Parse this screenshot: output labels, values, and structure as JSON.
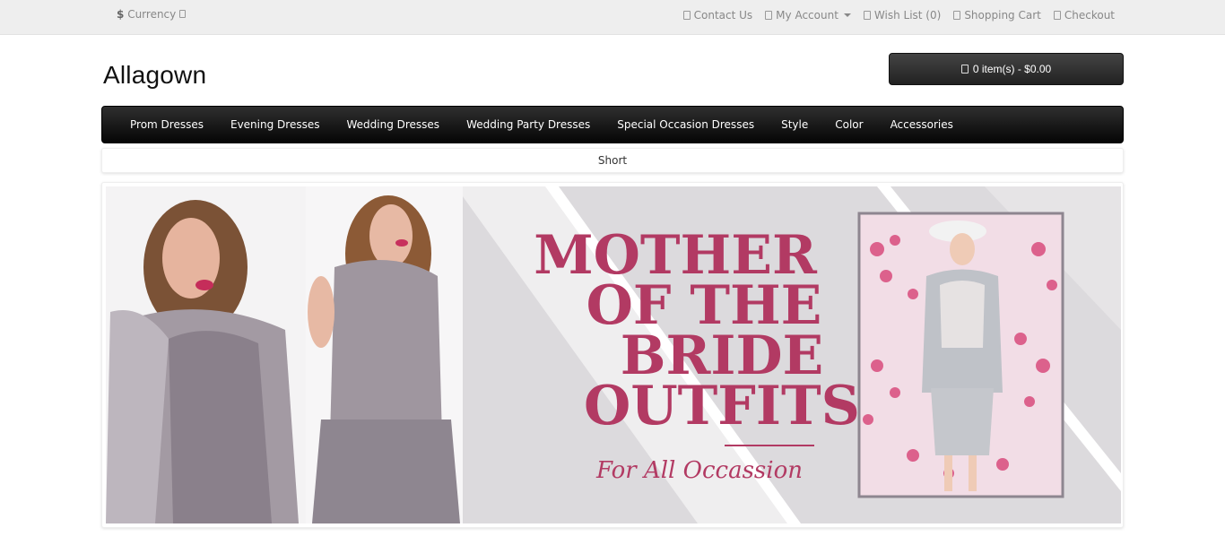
{
  "topbar": {
    "currency_symbol": "$",
    "currency_label": "Currency",
    "links": [
      {
        "label": "Contact Us",
        "icon": "phone-icon"
      },
      {
        "label": "My Account",
        "icon": "user-icon"
      },
      {
        "label": "Wish List (0)",
        "icon": "heart-icon"
      },
      {
        "label": "Shopping Cart",
        "icon": "cart-icon"
      },
      {
        "label": "Checkout",
        "icon": "share-icon"
      }
    ]
  },
  "header": {
    "logo": "Allagown",
    "cart_label": "0 item(s) - $0.00"
  },
  "nav": {
    "items": [
      "Prom Dresses",
      "Evening Dresses",
      "Wedding Dresses",
      "Wedding Party Dresses",
      "Special Occasion Dresses",
      "Style",
      "Color",
      "Accessories"
    ]
  },
  "subnav": {
    "label": "Short"
  },
  "banner": {
    "title_line1": "MOTHER",
    "title_line2": "OF THE",
    "title_line3": "BRIDE",
    "title_line4": "OUTFITS",
    "tagline": "For All Occassion",
    "accent_color": "#b23a63",
    "background_color": "#dddcde"
  }
}
